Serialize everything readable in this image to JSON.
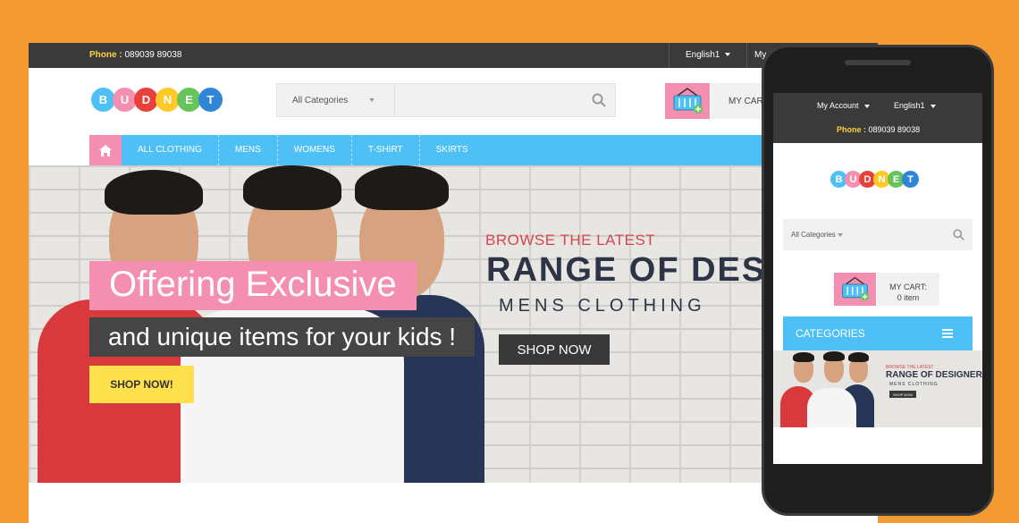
{
  "desktop": {
    "topbar": {
      "phone_label": "Phone :",
      "phone_number": "089039 89038",
      "language": "English1",
      "account": "My Account"
    },
    "logo": [
      "B",
      "U",
      "D",
      "N",
      "E",
      "T"
    ],
    "logo_colors": [
      "#4fc0f5",
      "#f48fb1",
      "#e8413a",
      "#ffc928",
      "#66c45a",
      "#2f86d6"
    ],
    "search": {
      "category": "All Categories",
      "icon": "search-icon"
    },
    "cart": {
      "label": "MY CART:",
      "icon": "basket-icon"
    },
    "nav": {
      "home_icon": "home-icon",
      "items": [
        "ALL CLOTHING",
        "MENS",
        "WOMENS",
        "T-SHIRT",
        "SKIRTS"
      ]
    },
    "banner": {
      "headline": "Offering Exclusive",
      "subline": "and unique items for your kids !",
      "cta": "SHOP NOW!",
      "browse": "BROWSE THE LATEST",
      "range": "RANGE OF DESIGNER",
      "mens": "MENS CLOTHING",
      "shop": "SHOP NOW"
    }
  },
  "mobile": {
    "account": "My Account",
    "language": "English1",
    "phone_label": "Phone :",
    "phone_number": "089039 89038",
    "search_category": "All Categories",
    "cart_label": "MY CART:",
    "cart_count": "0 item",
    "categories": "CATEGORIES",
    "banner": {
      "browse": "BROWSE THE LATEST",
      "range": "RANGE OF DESIGNER",
      "mens": "MENS CLOTHING",
      "shop": "SHOP NOW"
    }
  },
  "colors": {
    "background": "#f39a33",
    "accent_blue": "#4fc0f5",
    "accent_pink": "#f48fb1",
    "accent_yellow": "#ffe14d",
    "dark": "#3a3a3a"
  }
}
